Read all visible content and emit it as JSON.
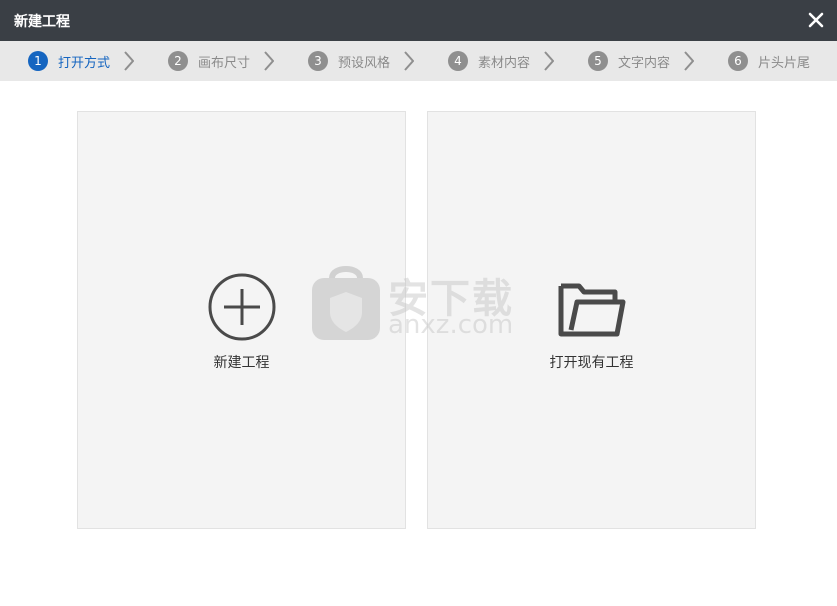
{
  "window": {
    "title": "新建工程"
  },
  "steps": [
    {
      "num": "1",
      "label": "打开方式",
      "active": true
    },
    {
      "num": "2",
      "label": "画布尺寸",
      "active": false
    },
    {
      "num": "3",
      "label": "预设风格",
      "active": false
    },
    {
      "num": "4",
      "label": "素材内容",
      "active": false
    },
    {
      "num": "5",
      "label": "文字内容",
      "active": false
    },
    {
      "num": "6",
      "label": "片头片尾",
      "active": false
    }
  ],
  "cards": {
    "new": {
      "label": "新建工程",
      "icon": "plus-circle-icon"
    },
    "open": {
      "label": "打开现有工程",
      "icon": "folder-icon"
    }
  },
  "watermark": {
    "text": "安下载",
    "domain": "anxz.com"
  },
  "colors": {
    "titlebar": "#3a3f45",
    "accent": "#1565c0",
    "stepbar": "#e8e8e8"
  }
}
